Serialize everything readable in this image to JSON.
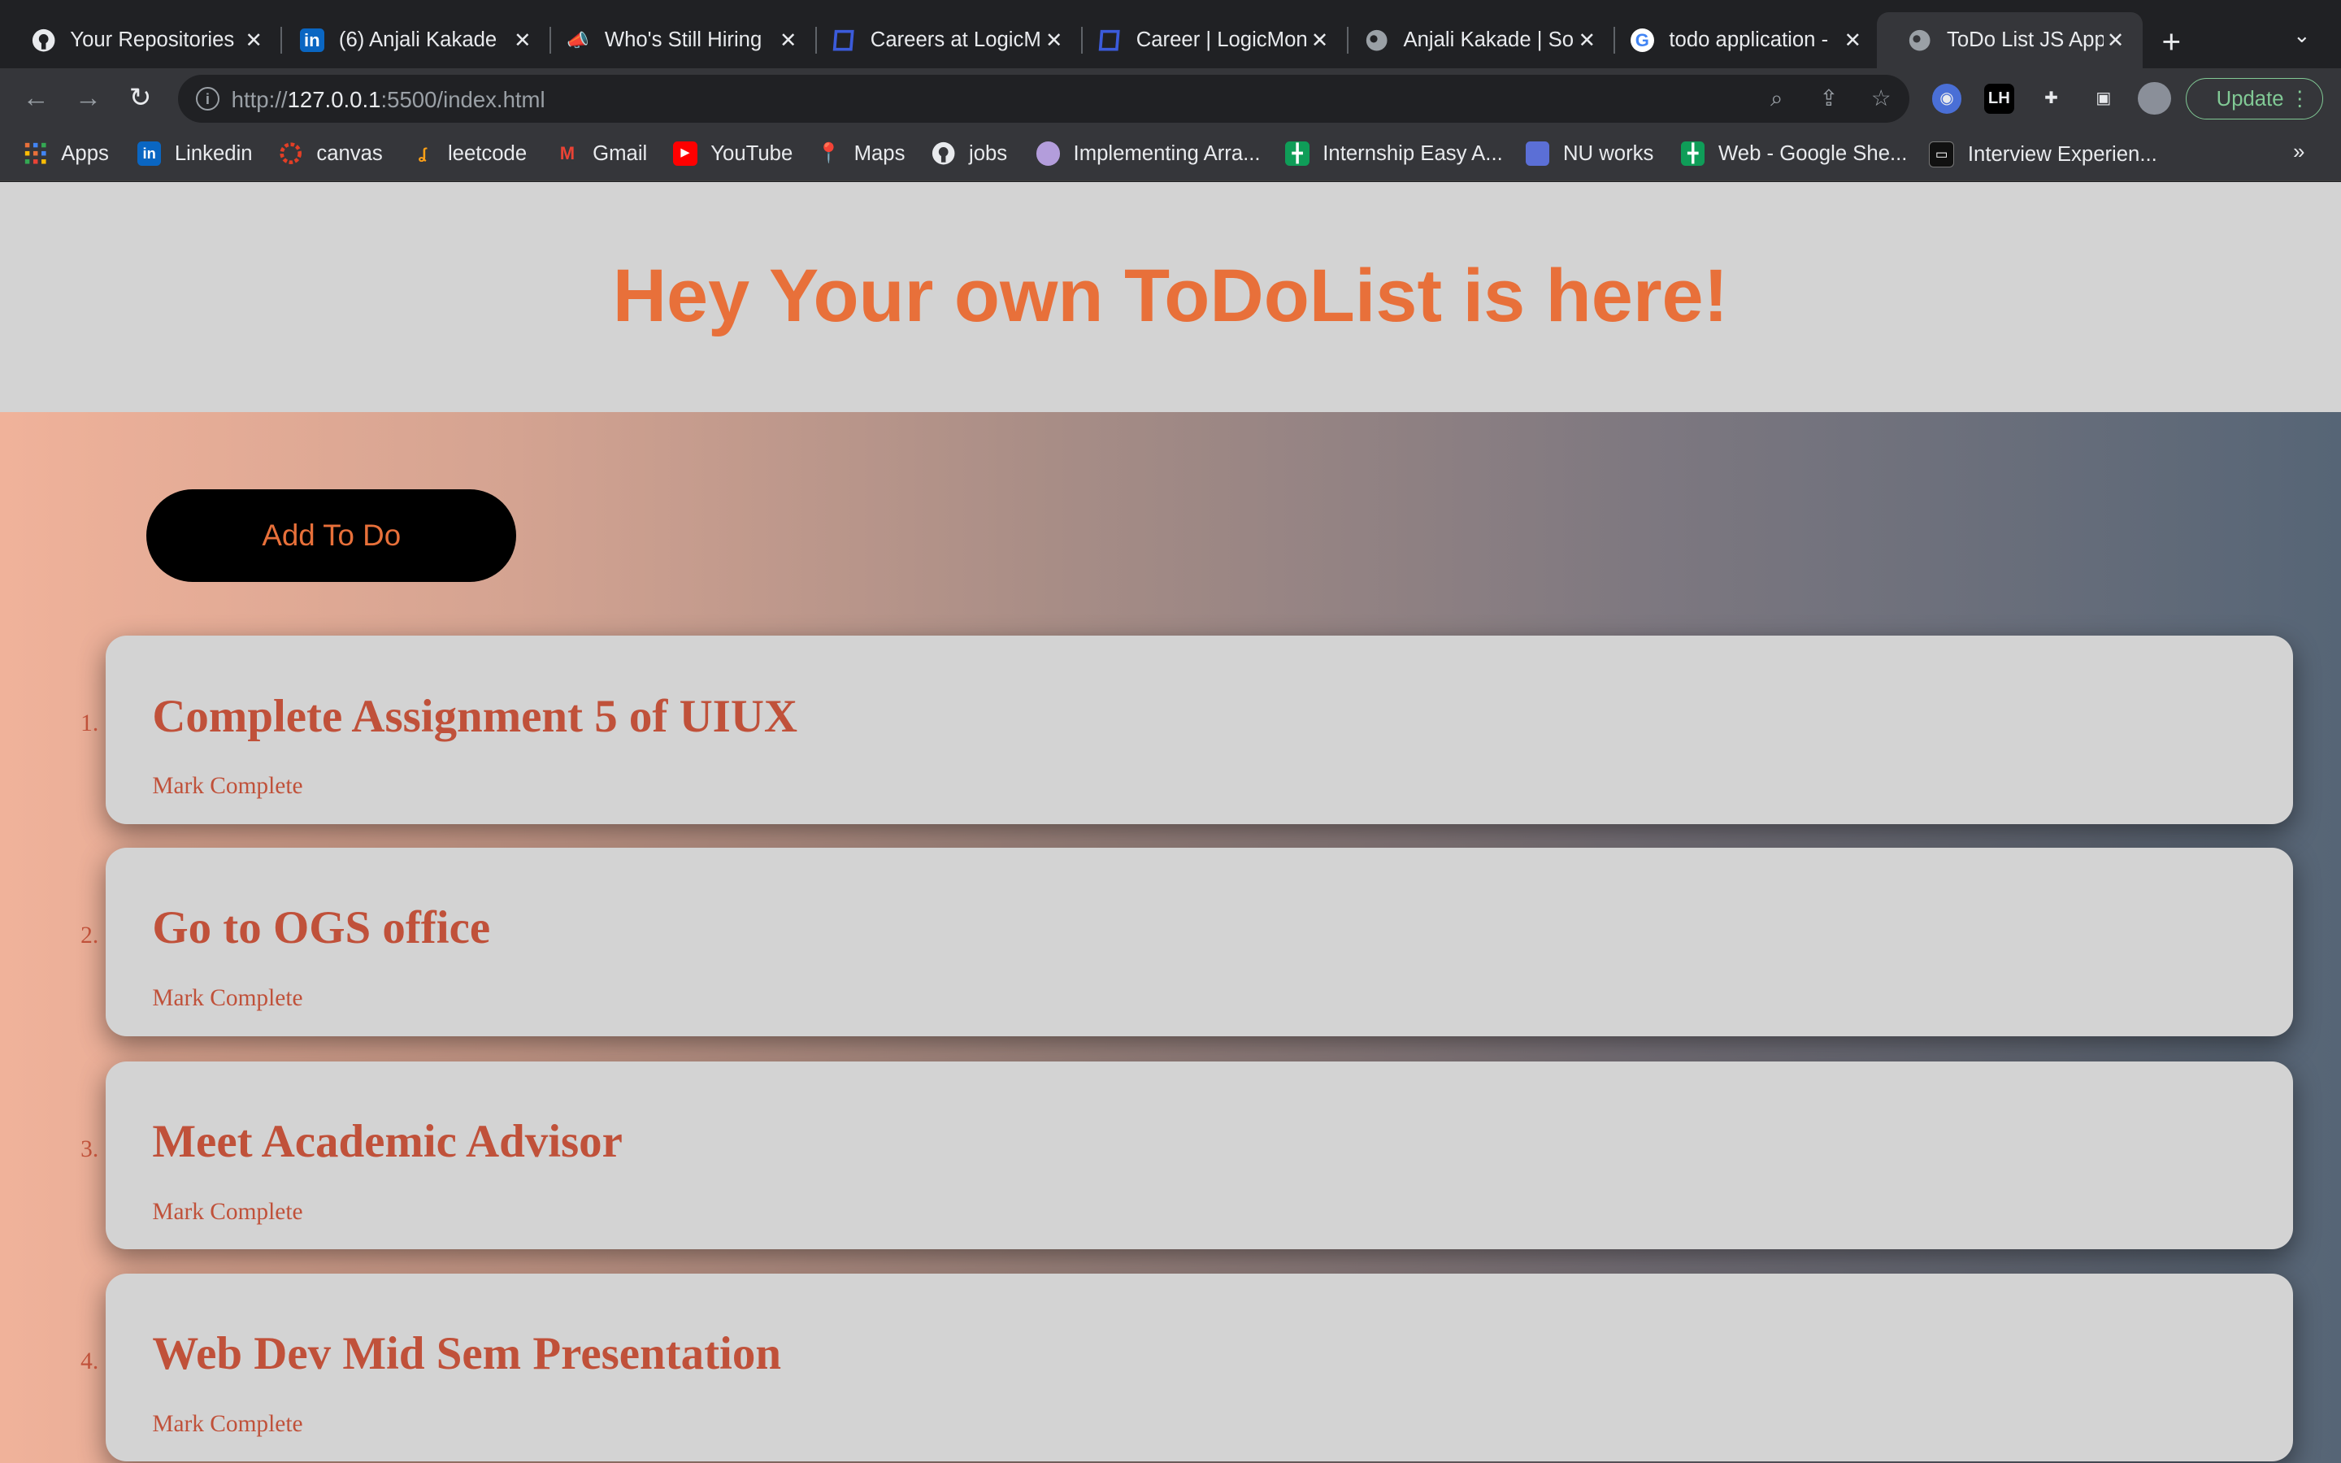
{
  "browser": {
    "tabs": [
      {
        "label": "Your Repositories",
        "icon": "github-icon"
      },
      {
        "label": "(6) Anjali Kakade",
        "icon": "linkedin-icon"
      },
      {
        "label": "Who's Still Hiring",
        "icon": "megaphone-icon"
      },
      {
        "label": "Careers at LogicM",
        "icon": "logicmonitor-icon"
      },
      {
        "label": "Career | LogicMon",
        "icon": "logicmonitor-icon"
      },
      {
        "label": "Anjali Kakade | So",
        "icon": "globe-icon"
      },
      {
        "label": "todo application -",
        "icon": "google-icon"
      },
      {
        "label": "ToDo List JS App",
        "icon": "globe-icon",
        "active": true
      }
    ],
    "url_scheme": "http://",
    "url_host": "127.0.0.1",
    "url_path": ":5500/index.html",
    "update_label": "Update",
    "bookmarks": [
      {
        "label": "Apps",
        "icon": "apps-grid-icon"
      },
      {
        "label": "Linkedin",
        "icon": "linkedin-icon"
      },
      {
        "label": "canvas",
        "icon": "canvas-icon"
      },
      {
        "label": "leetcode",
        "icon": "leetcode-icon"
      },
      {
        "label": "Gmail",
        "icon": "gmail-icon"
      },
      {
        "label": "YouTube",
        "icon": "youtube-icon"
      },
      {
        "label": "Maps",
        "icon": "maps-icon"
      },
      {
        "label": "jobs",
        "icon": "github-icon"
      },
      {
        "label": "Implementing Arra...",
        "icon": "avatar-icon"
      },
      {
        "label": "Internship Easy A...",
        "icon": "sheets-icon"
      },
      {
        "label": "NU works",
        "icon": "nuworks-icon"
      },
      {
        "label": "Web - Google She...",
        "icon": "sheets-icon"
      },
      {
        "label": "Interview Experien...",
        "icon": "laptop-icon"
      }
    ]
  },
  "app": {
    "title": "Hey Your own ToDoList is here!",
    "add_button": "Add To Do",
    "todos": [
      {
        "num": "1.",
        "title": "Complete Assignment 5 of UIUX",
        "action": "Mark Complete"
      },
      {
        "num": "2.",
        "title": "Go to OGS office",
        "action": "Mark Complete"
      },
      {
        "num": "3.",
        "title": "Meet Academic Advisor",
        "action": "Mark Complete"
      },
      {
        "num": "4.",
        "title": "Web Dev Mid Sem Presentation",
        "action": "Mark Complete"
      }
    ]
  },
  "colors": {
    "accent": "#e8703a",
    "todo_text": "#c0513a",
    "header_bg": "#d3d3d3"
  }
}
